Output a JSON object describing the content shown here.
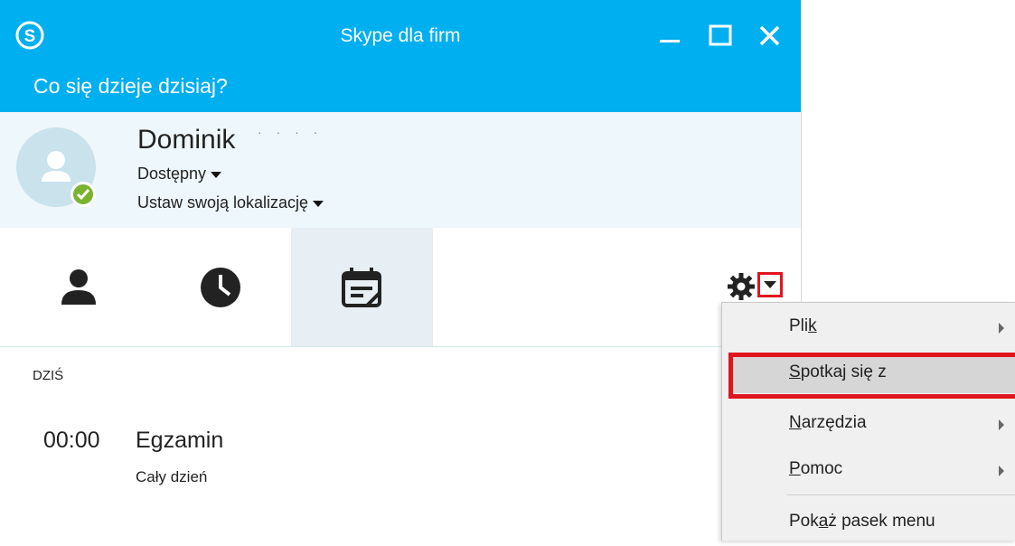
{
  "window": {
    "title": "Skype dla firm"
  },
  "status_prompt": "Co się dzieje dzisiaj?",
  "profile": {
    "name": "Dominik",
    "surname_obscured": "· · · ·",
    "presence": "Dostępny",
    "location": "Ustaw swoją lokalizację"
  },
  "tabs": [
    {
      "icon": "contacts-icon",
      "selected": false
    },
    {
      "icon": "history-clock-icon",
      "selected": false
    },
    {
      "icon": "meetings-calendar-icon",
      "selected": true
    }
  ],
  "meetings": {
    "section": "DZIŚ",
    "events": [
      {
        "time": "00:00",
        "title": "Egzamin",
        "subtitle": "Cały dzień"
      }
    ]
  },
  "menu": {
    "items": [
      {
        "pre": "Pli",
        "u": "k",
        "post": "",
        "submenu": true
      },
      {
        "pre": "",
        "u": "S",
        "post": "potkaj się z",
        "submenu": false,
        "highlighted": true
      },
      {
        "pre": "",
        "u": "N",
        "post": "arzędzia",
        "submenu": true
      },
      {
        "pre": "",
        "u": "P",
        "post": "omoc",
        "submenu": true
      },
      {
        "pre": "Pok",
        "u": "a",
        "post": "ż pasek menu",
        "submenu": false
      }
    ]
  },
  "colors": {
    "accent": "#00aff0",
    "highlight_border": "#e0141e",
    "presence_available": "#7bb22e"
  }
}
